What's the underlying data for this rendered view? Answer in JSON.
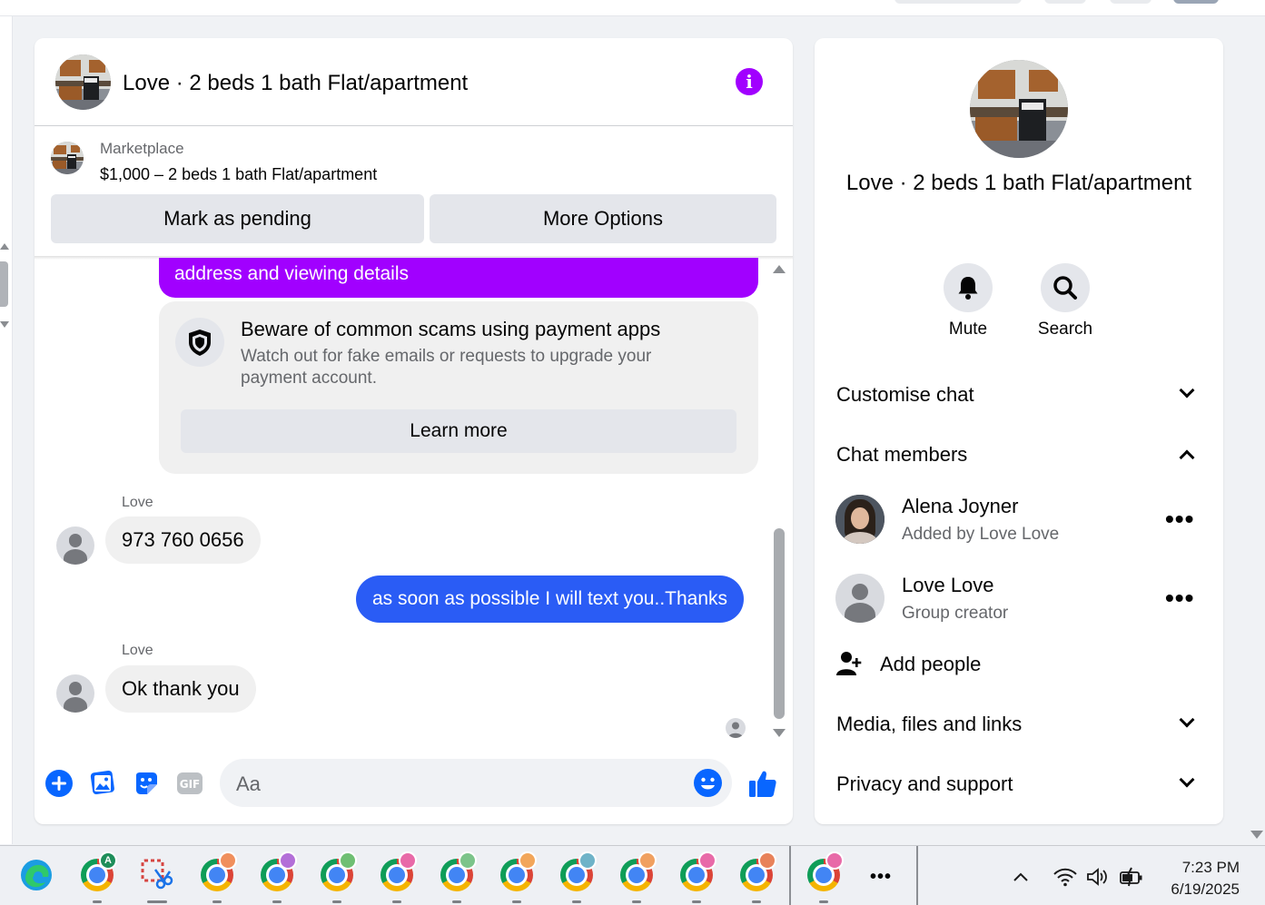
{
  "chat": {
    "title": "Love · 2 beds 1 bath Flat/apartment",
    "marketplace": {
      "source": "Marketplace",
      "listing": "$1,000 – 2 beds 1 bath Flat/apartment",
      "mark_pending": "Mark as pending",
      "more_options": "More Options"
    },
    "messages": {
      "outgoing_partial": "address and viewing details",
      "scam_notice": {
        "title": "Beware of common scams using payment apps",
        "body": "Watch out for fake emails or requests to upgrade your payment account.",
        "cta": "Learn more"
      },
      "msg1_sender": "Love",
      "msg1_text": "973 760 0656",
      "msg2_text": "as soon as possible I will text you..Thanks",
      "msg3_sender": "Love",
      "msg3_text": "Ok thank you"
    },
    "composer": {
      "placeholder": "Aa",
      "gif_label": "GIF"
    }
  },
  "side_panel": {
    "title": "Love · 2 beds 1 bath Flat/apartment",
    "mute_label": "Mute",
    "search_label": "Search",
    "customise_chat": "Customise chat",
    "chat_members": "Chat members",
    "members": [
      {
        "name": "Alena Joyner",
        "sub": "Added by Love Love"
      },
      {
        "name": "Love Love",
        "sub": "Group creator"
      }
    ],
    "add_people": "Add people",
    "media_files_links": "Media, files and links",
    "privacy_support": "Privacy and support"
  },
  "taskbar": {
    "time": "7:23 PM",
    "date": "6/19/2025",
    "profile_badge": "A"
  },
  "colors": {
    "accent_purple": "#a100ff",
    "outgoing_blue": "#2a5cf5",
    "messenger_blue": "#0866ff"
  }
}
